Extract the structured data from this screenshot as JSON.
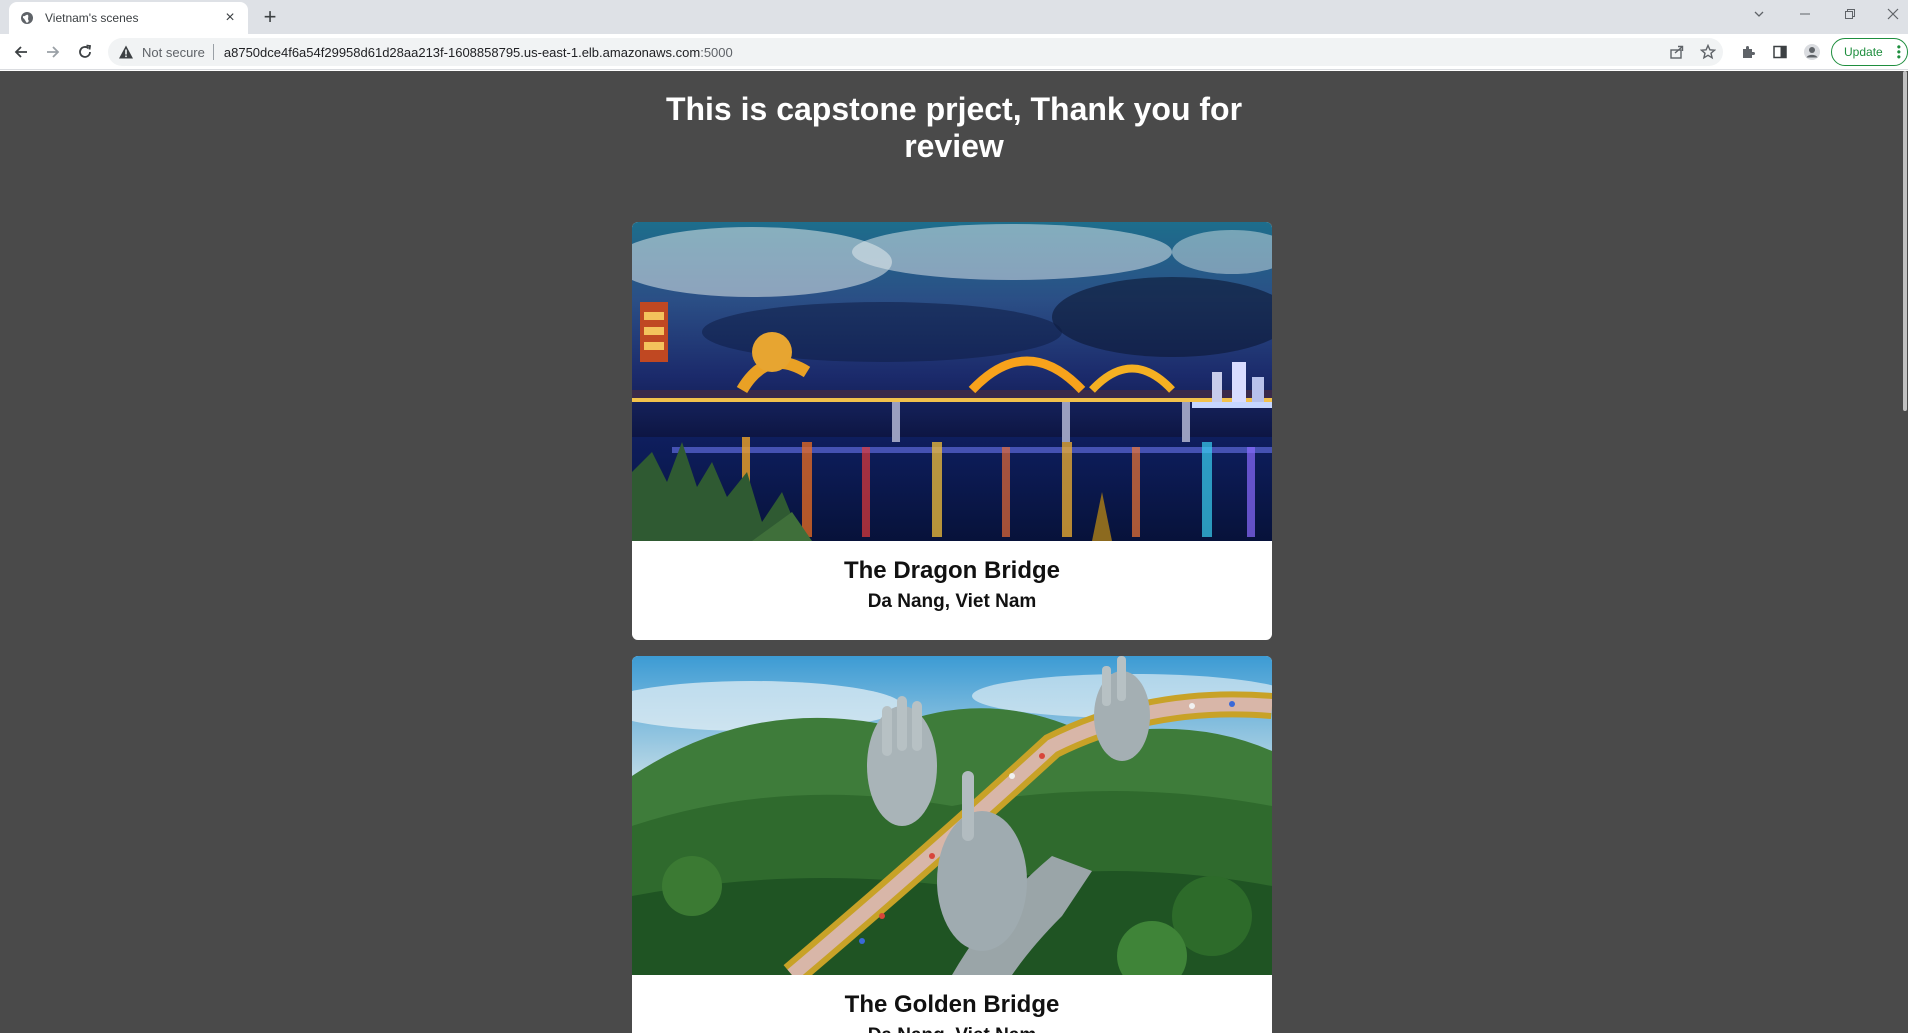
{
  "browser": {
    "tab_title": "Vietnam's scenes",
    "tab_close_label": "×",
    "new_tab_label": "+",
    "not_secure_label": "Not secure",
    "url_host": "a8750dce4f6a54f29958d61d28aa213f-1608858795.us-east-1.elb.amazonaws.com",
    "url_port": ":5000",
    "update_label": "Update",
    "accent_color": "#1e8e3e"
  },
  "page": {
    "title": "This is capstone prject, Thank you for review",
    "background_color": "#4a4a4a"
  },
  "cards": [
    {
      "name": "The Dragon Bridge",
      "location": "Da Nang, Viet Nam",
      "image_icon": "dragon-bridge-night-photo"
    },
    {
      "name": "The Golden Bridge",
      "location": "Da Nang, Viet Nam",
      "image_icon": "golden-bridge-hands-photo"
    }
  ]
}
